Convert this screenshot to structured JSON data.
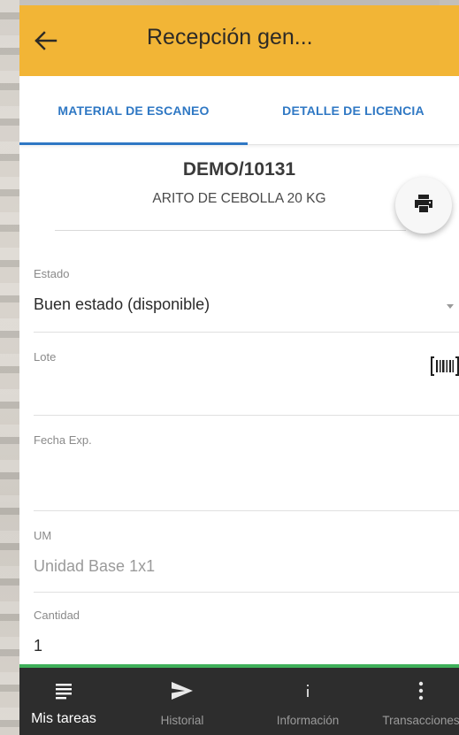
{
  "app_bar": {
    "title": "Recepción gen...",
    "back_icon": "arrow-left-icon",
    "color": "#f2b536"
  },
  "tabs": [
    {
      "label": "MATERIAL DE ESCANEO",
      "active": true
    },
    {
      "label": "DETALLE DE LICENCIA",
      "active": false
    }
  ],
  "accent_color": "#2f78c4",
  "product": {
    "code": "DEMO/10131",
    "description": "ARITO DE CEBOLLA 20 KG",
    "print_icon": "printer-icon"
  },
  "form": {
    "estado": {
      "label": "Estado",
      "value": "Buen estado (disponible)"
    },
    "lote": {
      "label": "Lote",
      "value": "",
      "scan_icon": "barcode-scan-icon"
    },
    "fecha_exp": {
      "label": "Fecha Exp.",
      "value": ""
    },
    "um": {
      "label": "UM",
      "value": "Unidad Base 1x1"
    },
    "cantidad": {
      "label": "Cantidad",
      "value": "1"
    }
  },
  "bottom_nav": {
    "items": [
      {
        "label": "Mis tareas",
        "icon": "task-list-icon",
        "active": true
      },
      {
        "label": "Historial",
        "icon": "send-icon",
        "active": false
      },
      {
        "label": "Información",
        "icon": "info-icon",
        "active": false
      },
      {
        "label": "Transacciones",
        "icon": "more-vertical-icon",
        "active": false
      }
    ],
    "accent_color": "#3fb05a"
  }
}
